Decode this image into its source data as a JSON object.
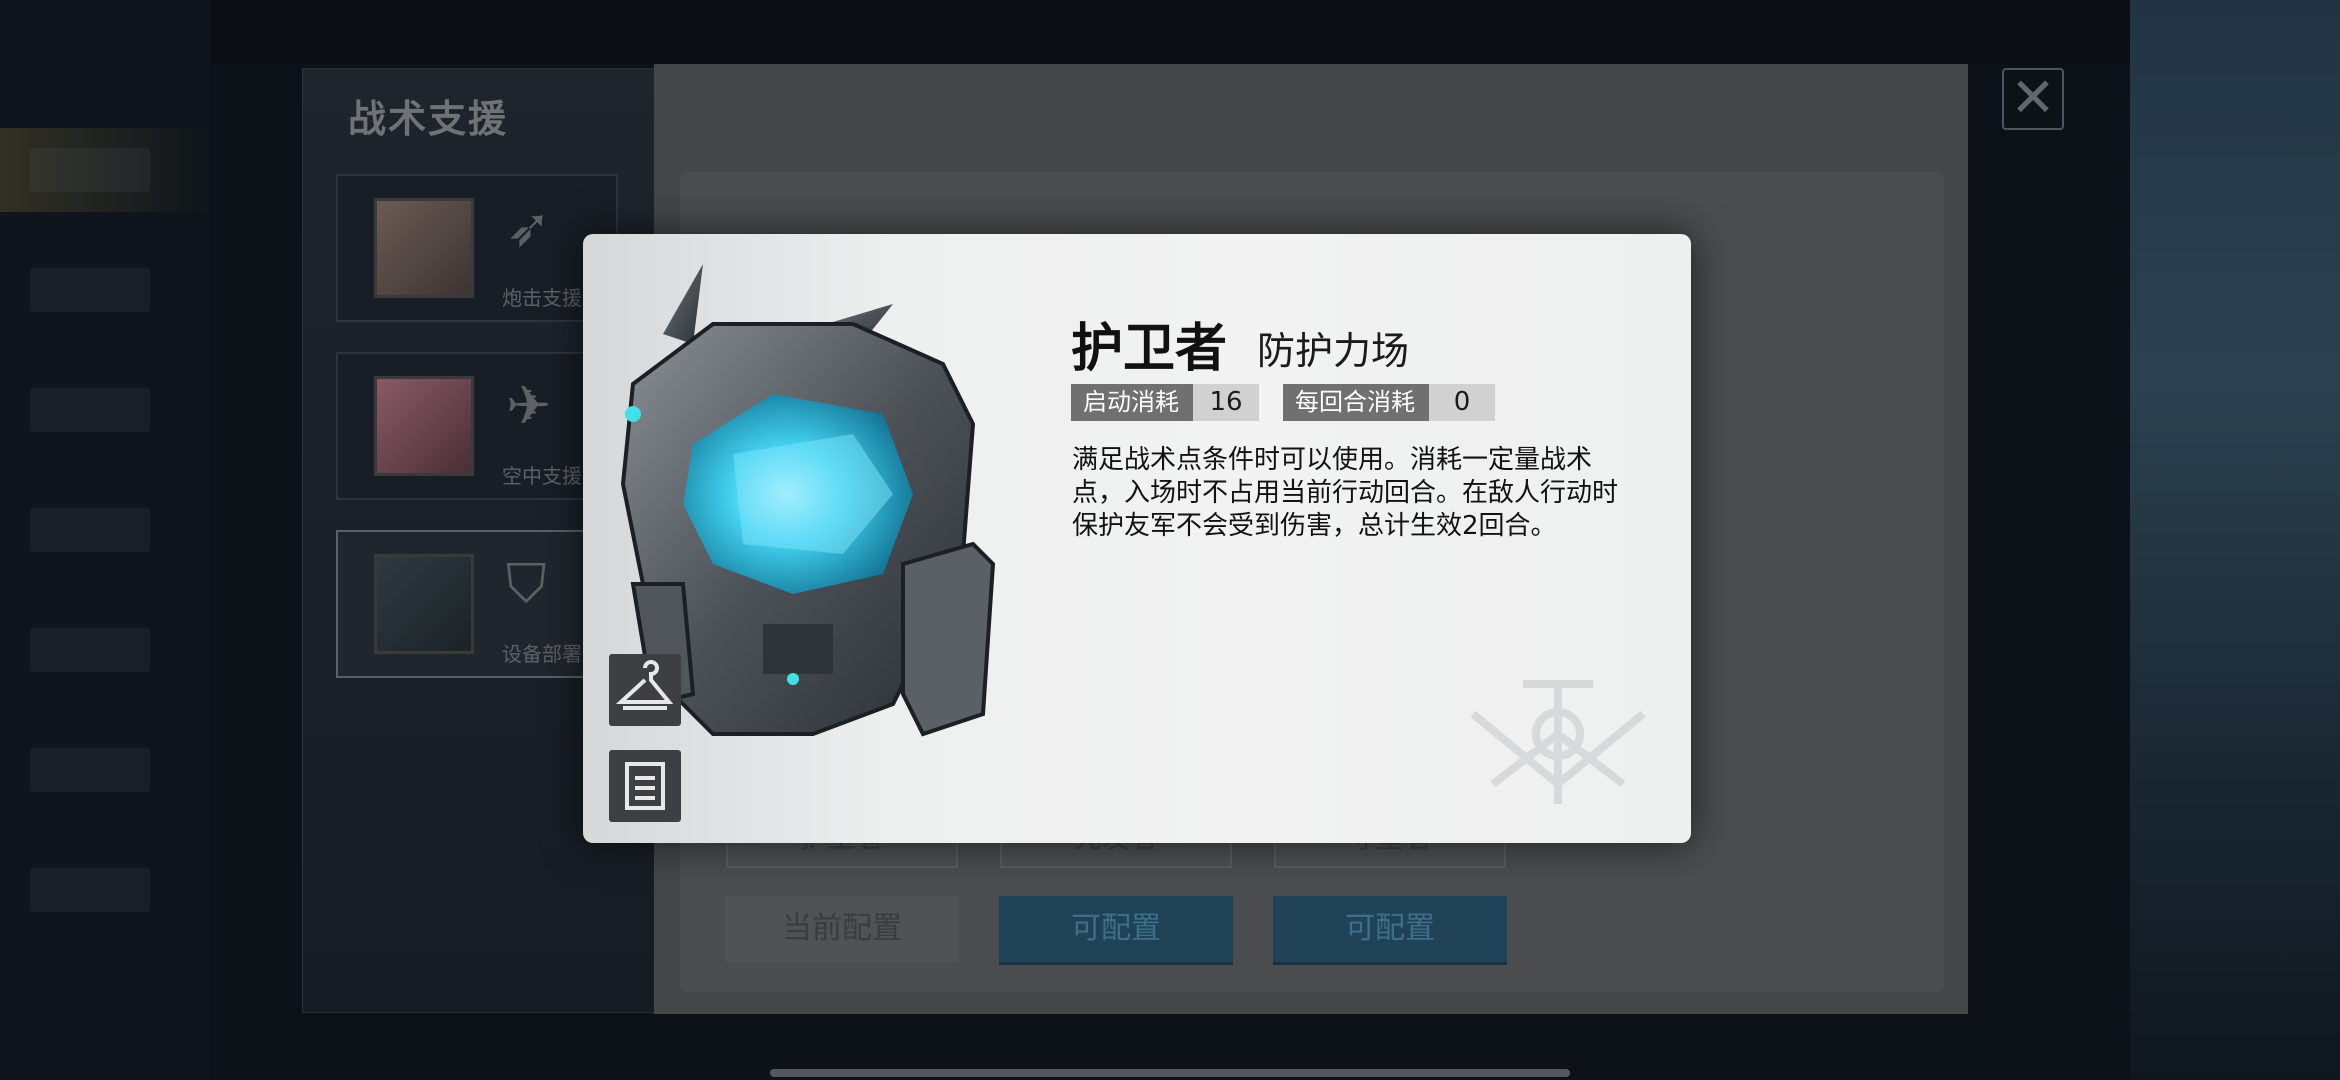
{
  "background": {
    "support_title": "战术支援",
    "support_cards": [
      {
        "label": "炮击支援"
      },
      {
        "label": "空中支援"
      },
      {
        "label": "设备部署"
      }
    ],
    "config_slots": [
      {
        "label": "护卫者",
        "button": "当前配置",
        "state": "current"
      },
      {
        "label": "先发者",
        "button": "可配置",
        "state": "available"
      },
      {
        "label": "守望者",
        "button": "可配置",
        "state": "available"
      }
    ],
    "close_icon": "close-x"
  },
  "modal": {
    "name": "护卫者",
    "type": "防护力场",
    "stats": {
      "start_cost_label": "启动消耗",
      "start_cost_value": "16",
      "turn_cost_label": "每回合消耗",
      "turn_cost_value": "0"
    },
    "description": "满足战术点条件时可以使用。消耗一定量战术点，入场时不占用当前行动回合。在敌人行动时保护友军不会受到伤害，总计生效2回合。",
    "side_buttons": [
      {
        "icon": "hanger-icon"
      },
      {
        "icon": "document-icon"
      }
    ]
  }
}
